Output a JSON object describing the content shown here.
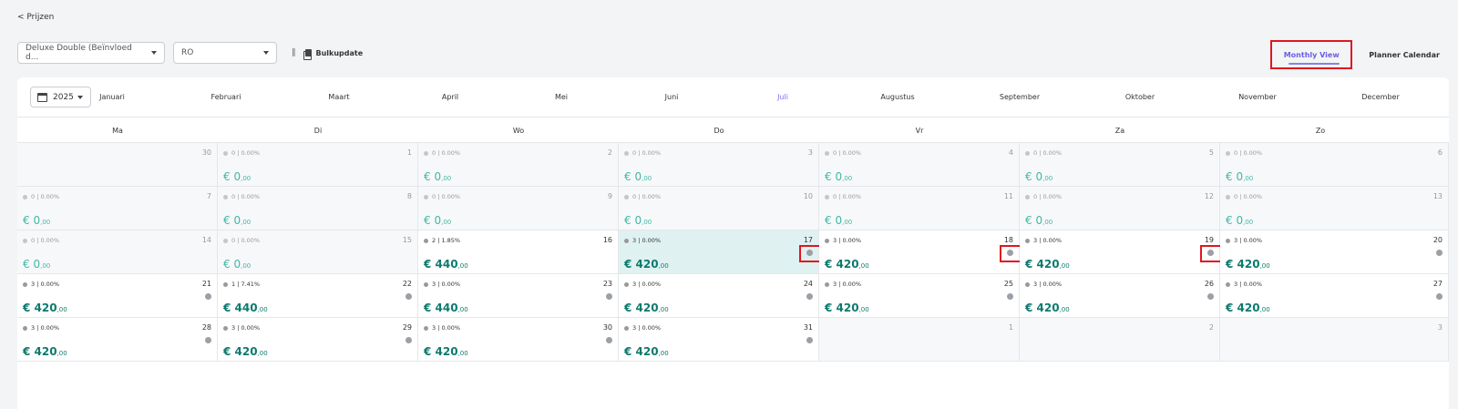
{
  "back_link": "< Prijzen",
  "toolbar": {
    "room_select": "Deluxe Double (Beïnvloed d...",
    "rate_select": "RO",
    "bulk_label": "Bulkupdate"
  },
  "views": {
    "monthly": "Monthly View",
    "planner": "Planner Calendar"
  },
  "calendar": {
    "year": "2025",
    "months": [
      "Januari",
      "Februari",
      "Maart",
      "April",
      "Mei",
      "Juni",
      "Juli",
      "Augustus",
      "September",
      "Oktober",
      "November",
      "December"
    ],
    "active_month": "Juli",
    "weekdays": [
      "Ma",
      "Di",
      "Wo",
      "Do",
      "Vr",
      "Za",
      "Zo"
    ],
    "cells": [
      {
        "day": "30",
        "outside": true
      },
      {
        "day": "1",
        "stat": "0 | 0.00%",
        "price": "€ 0",
        "cents": ",00",
        "past": true
      },
      {
        "day": "2",
        "stat": "0 | 0.00%",
        "price": "€ 0",
        "cents": ",00",
        "past": true
      },
      {
        "day": "3",
        "stat": "0 | 0.00%",
        "price": "€ 0",
        "cents": ",00",
        "past": true
      },
      {
        "day": "4",
        "stat": "0 | 0.00%",
        "price": "€ 0",
        "cents": ",00",
        "past": true
      },
      {
        "day": "5",
        "stat": "0 | 0.00%",
        "price": "€ 0",
        "cents": ",00",
        "past": true
      },
      {
        "day": "6",
        "stat": "0 | 0.00%",
        "price": "€ 0",
        "cents": ",00",
        "past": true
      },
      {
        "day": "7",
        "stat": "0 | 0.00%",
        "price": "€ 0",
        "cents": ",00",
        "past": true
      },
      {
        "day": "8",
        "stat": "0 | 0.00%",
        "price": "€ 0",
        "cents": ",00",
        "past": true
      },
      {
        "day": "9",
        "stat": "0 | 0.00%",
        "price": "€ 0",
        "cents": ",00",
        "past": true
      },
      {
        "day": "10",
        "stat": "0 | 0.00%",
        "price": "€ 0",
        "cents": ",00",
        "past": true
      },
      {
        "day": "11",
        "stat": "0 | 0.00%",
        "price": "€ 0",
        "cents": ",00",
        "past": true
      },
      {
        "day": "12",
        "stat": "0 | 0.00%",
        "price": "€ 0",
        "cents": ",00",
        "past": true
      },
      {
        "day": "13",
        "stat": "0 | 0.00%",
        "price": "€ 0",
        "cents": ",00",
        "past": true
      },
      {
        "day": "14",
        "stat": "0 | 0.00%",
        "price": "€ 0",
        "cents": ",00",
        "past": true
      },
      {
        "day": "15",
        "stat": "0 | 0.00%",
        "price": "€ 0",
        "cents": ",00",
        "past": true
      },
      {
        "day": "16",
        "stat": "2 | 1.85%",
        "price": "€ 440",
        "cents": ",00"
      },
      {
        "day": "17",
        "stat": "3 | 0.00%",
        "price": "€ 420",
        "cents": ",00",
        "today": true,
        "toggle": true,
        "highlight": true
      },
      {
        "day": "18",
        "stat": "3 | 0.00%",
        "price": "€ 420",
        "cents": ",00",
        "toggle": true,
        "highlight": true
      },
      {
        "day": "19",
        "stat": "3 | 0.00%",
        "price": "€ 420",
        "cents": ",00",
        "toggle": true,
        "highlight": true
      },
      {
        "day": "20",
        "stat": "3 | 0.00%",
        "price": "€ 420",
        "cents": ",00",
        "toggle": true
      },
      {
        "day": "21",
        "stat": "3 | 0.00%",
        "price": "€ 420",
        "cents": ",00",
        "toggle": true
      },
      {
        "day": "22",
        "stat": "1 | 7.41%",
        "price": "€ 440",
        "cents": ",00",
        "toggle": true
      },
      {
        "day": "23",
        "stat": "3 | 0.00%",
        "price": "€ 440",
        "cents": ",00",
        "toggle": true
      },
      {
        "day": "24",
        "stat": "3 | 0.00%",
        "price": "€ 420",
        "cents": ",00",
        "toggle": true
      },
      {
        "day": "25",
        "stat": "3 | 0.00%",
        "price": "€ 420",
        "cents": ",00",
        "toggle": true
      },
      {
        "day": "26",
        "stat": "3 | 0.00%",
        "price": "€ 420",
        "cents": ",00",
        "toggle": true
      },
      {
        "day": "27",
        "stat": "3 | 0.00%",
        "price": "€ 420",
        "cents": ",00",
        "toggle": true
      },
      {
        "day": "28",
        "stat": "3 | 0.00%",
        "price": "€ 420",
        "cents": ",00",
        "toggle": true
      },
      {
        "day": "29",
        "stat": "3 | 0.00%",
        "price": "€ 420",
        "cents": ",00",
        "toggle": true
      },
      {
        "day": "30",
        "stat": "3 | 0.00%",
        "price": "€ 420",
        "cents": ",00",
        "toggle": true
      },
      {
        "day": "31",
        "stat": "3 | 0.00%",
        "price": "€ 420",
        "cents": ",00",
        "toggle": true
      },
      {
        "day": "1",
        "outside": true
      },
      {
        "day": "2",
        "outside": true
      },
      {
        "day": "3",
        "outside": true
      }
    ]
  }
}
